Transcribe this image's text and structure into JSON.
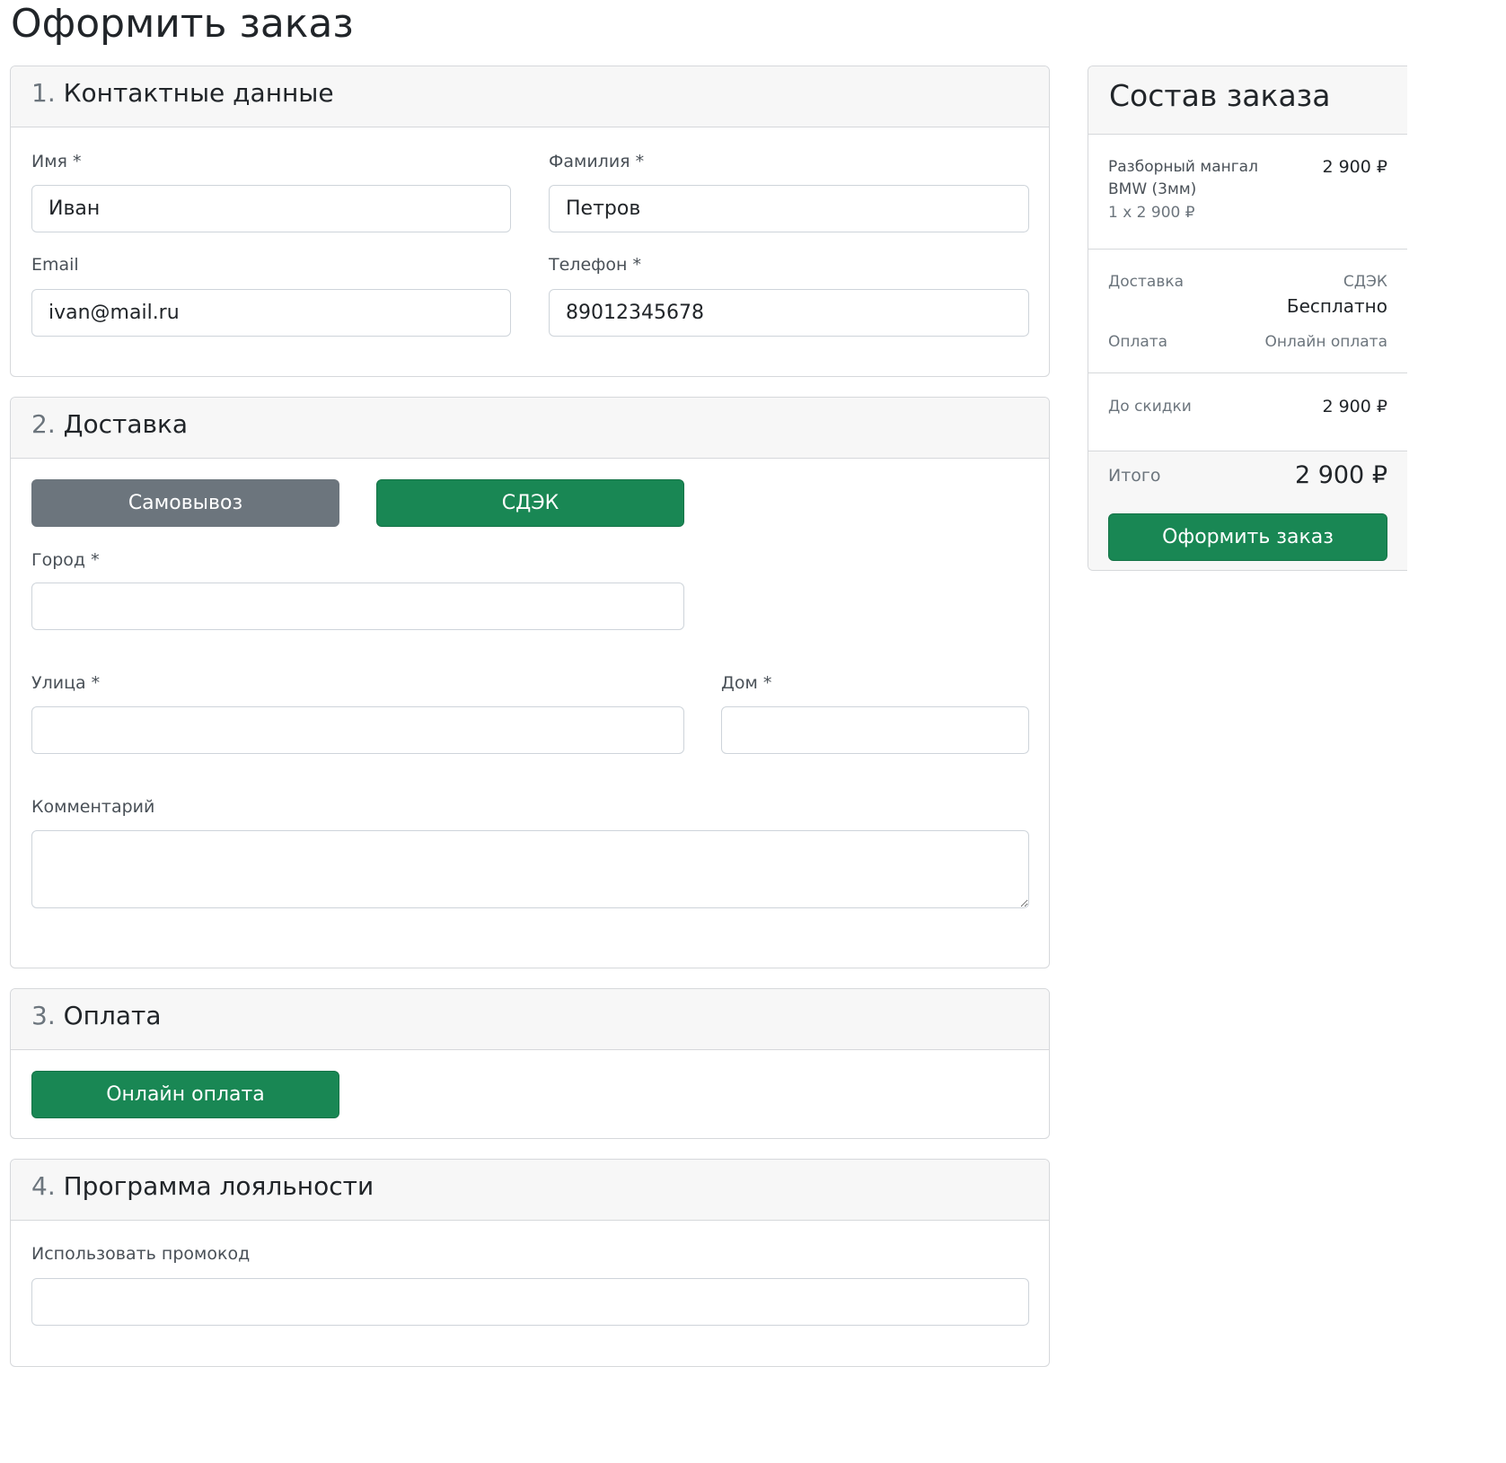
{
  "page": {
    "title": "Оформить заказ"
  },
  "contacts": {
    "num": "1.",
    "title": "Контактные данные",
    "first_name_label": "Имя *",
    "first_name_value": "Иван",
    "last_name_label": "Фамилия *",
    "last_name_value": "Петров",
    "email_label": "Email",
    "email_value": "ivan@mail.ru",
    "phone_label": "Телефон *",
    "phone_value": "89012345678"
  },
  "delivery": {
    "num": "2.",
    "title": "Доставка",
    "options": [
      {
        "label": "Самовывоз",
        "selected": false
      },
      {
        "label": "СДЭК",
        "selected": true
      }
    ],
    "city_label": "Город *",
    "city_value": "",
    "street_label": "Улица *",
    "street_value": "",
    "house_label": "Дом *",
    "house_value": "",
    "comment_label": "Комментарий",
    "comment_value": ""
  },
  "payment": {
    "num": "3.",
    "title": "Оплата",
    "option_label": "Онлайн оплата"
  },
  "loyalty": {
    "num": "4.",
    "title": "Программа лояльности",
    "promo_label": "Использовать промокод",
    "promo_value": ""
  },
  "summary": {
    "title": "Состав заказа",
    "item": {
      "name_line1": "Разборный мангал",
      "name_line2": "BMW (3мм)",
      "qty_price": "1 x 2 900 ₽",
      "price": "2 900 ₽"
    },
    "delivery_label": "Доставка",
    "delivery_method": "СДЭК",
    "delivery_cost": "Бесплатно",
    "payment_label": "Оплата",
    "payment_method": "Онлайн оплата",
    "before_discount_label": "До скидки",
    "before_discount_value": "2 900 ₽",
    "total_label": "Итого",
    "total_value": "2 900 ₽",
    "submit_label": "Оформить заказ"
  },
  "colors": {
    "accent_green": "#198754",
    "secondary_gray": "#6c757d",
    "header_bg": "#f7f7f7",
    "border": "#d6d8db"
  }
}
